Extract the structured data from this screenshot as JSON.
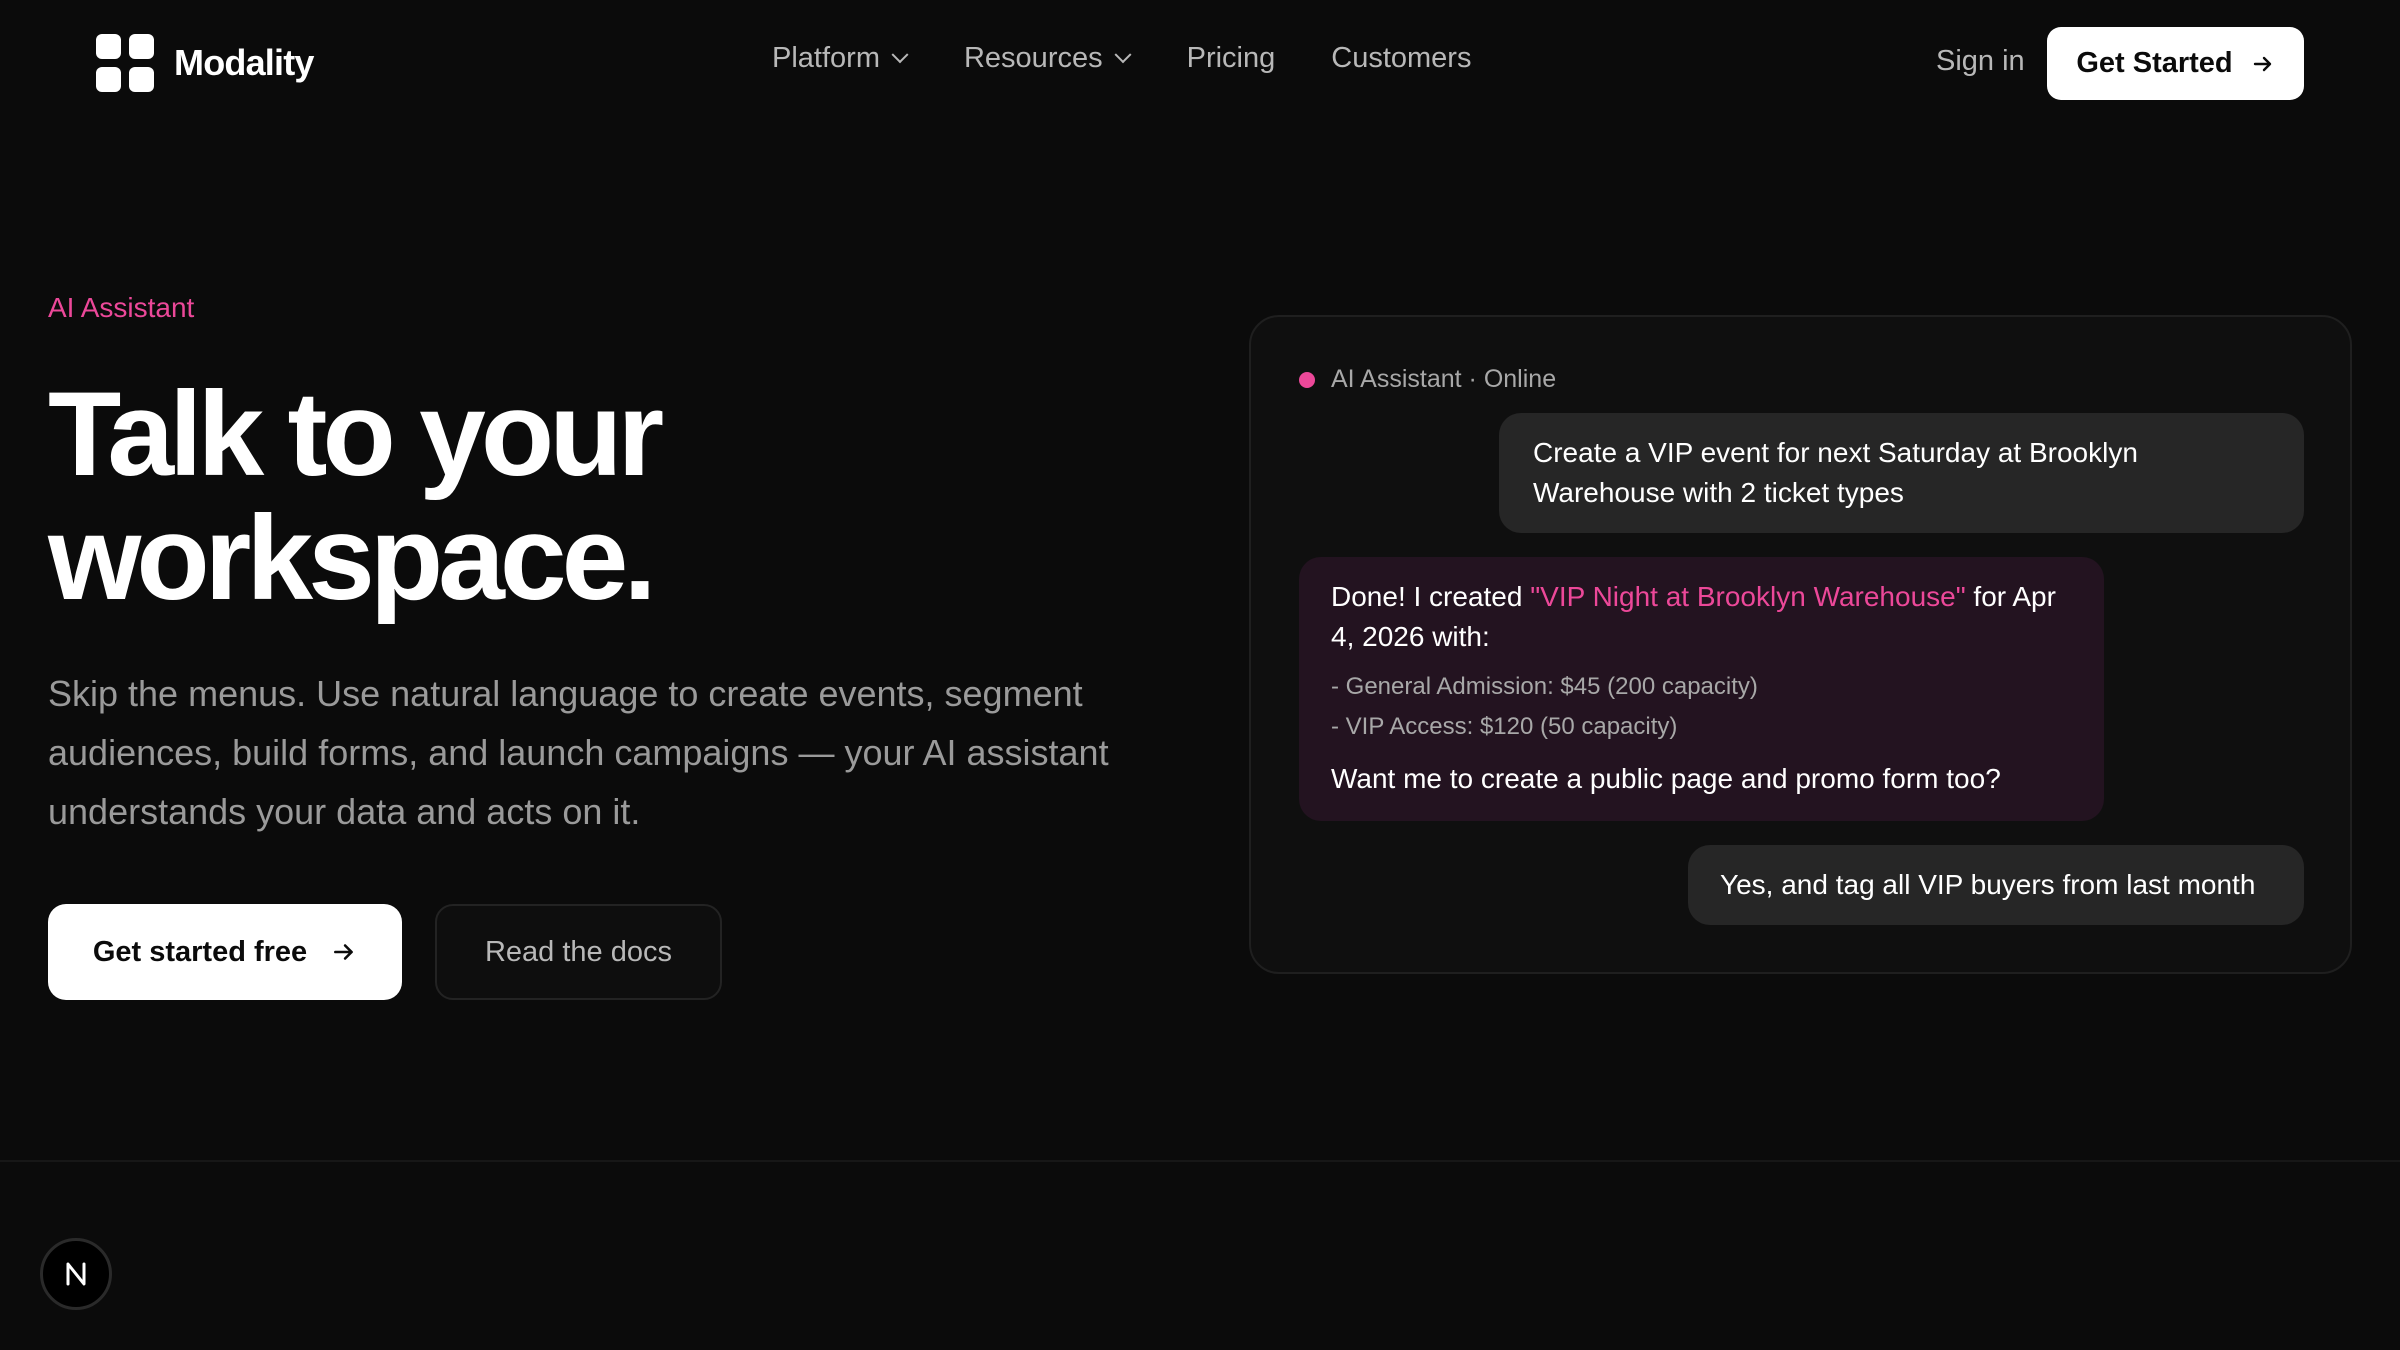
{
  "nav": {
    "brand": "Modality",
    "links": [
      {
        "label": "Platform",
        "has_dropdown": true
      },
      {
        "label": "Resources",
        "has_dropdown": true
      },
      {
        "label": "Pricing",
        "has_dropdown": false
      },
      {
        "label": "Customers",
        "has_dropdown": false
      }
    ],
    "sign_in": "Sign in",
    "get_started": "Get Started"
  },
  "hero": {
    "eyebrow": "AI Assistant",
    "headline_line1": "Talk to your",
    "headline_line2": "workspace.",
    "subtext": "Skip the menus. Use natural language to create events, segment audiences, build forms, and launch campaigns — your AI assistant understands your data and acts on it.",
    "cta_primary": "Get started free",
    "cta_secondary": "Read the docs"
  },
  "chat": {
    "status": "AI Assistant · Online",
    "user_message_1": "Create a VIP event for next Saturday at Brooklyn Warehouse with 2 ticket types",
    "ai_reply": {
      "prefix": "Done! I created ",
      "event_name": "\"VIP Night at Brooklyn Warehouse\"",
      "suffix": " for Apr 4, 2026 with:",
      "items": [
        "- General Admission: $45 (200 capacity)",
        "- VIP Access: $120 (50 capacity)"
      ],
      "question": "Want me to create a public page and promo form too?"
    },
    "user_message_2": "Yes, and tag all VIP buyers from last month"
  },
  "colors": {
    "background": "#0b0b0b",
    "accent": "#ec4899",
    "ai_bubble": "#231320",
    "user_bubble": "#262626"
  },
  "icons": {
    "logo": "four-rounded-squares-icon",
    "dropdown": "chevron-down-icon",
    "arrow": "arrow-right-icon",
    "status": "online-dot-icon",
    "badge": "n-letter-icon"
  }
}
